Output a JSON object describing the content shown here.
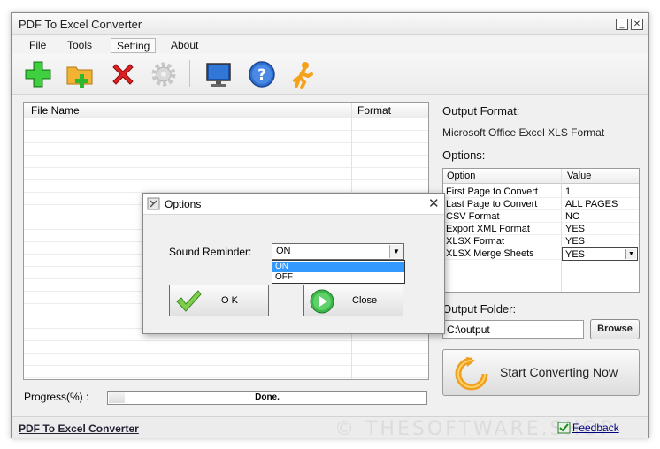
{
  "app": {
    "title": "PDF To Excel Converter"
  },
  "menu": {
    "items": [
      {
        "label": "File"
      },
      {
        "label": "Tools"
      },
      {
        "label": "Setting"
      },
      {
        "label": "About"
      }
    ]
  },
  "toolbar": {
    "icons": [
      "add-icon",
      "add-folder-icon",
      "remove-icon",
      "settings-icon",
      "monitor-icon",
      "help-icon",
      "running-man-icon"
    ]
  },
  "file_list": {
    "col_name": "File Name",
    "col_format": "Format"
  },
  "progress": {
    "label": "Progress(%)  :",
    "status": "Done.",
    "value": 0.05
  },
  "right_panel": {
    "output_format_label": "Output Format:",
    "output_format_value": "Microsoft Office Excel XLS Format",
    "options_label": "Options:",
    "options_table": {
      "col_option": "Option",
      "col_value": "Value",
      "rows": [
        {
          "option": "First Page to Convert",
          "value": "1"
        },
        {
          "option": "Last Page to Convert",
          "value": "ALL PAGES"
        },
        {
          "option": "CSV Format",
          "value": "NO"
        },
        {
          "option": "Export XML Format",
          "value": "YES"
        },
        {
          "option": "XLSX Format",
          "value": "YES"
        },
        {
          "option": "XLSX Merge Sheets",
          "value": "YES"
        }
      ]
    },
    "output_folder_label": "Output Folder:",
    "output_folder_value": "C:\\output",
    "browse_label": "Browse",
    "start_label": "Start Converting Now"
  },
  "status_bar": {
    "link": "PDF To Excel Converter",
    "feedback": "Feedback",
    "watermark": "© THESOFTWARE.SHOP"
  },
  "dialog": {
    "title": "Options",
    "sound_label": "Sound Reminder:",
    "sound_value": "ON",
    "sound_options": [
      "ON",
      "OFF"
    ],
    "ok_label": "O K",
    "close_label": "Close"
  },
  "colors": {
    "accent_blue": "#3399ff",
    "add_green": "#2eb82e",
    "remove_red": "#e02020",
    "start_orange": "#f0a020"
  }
}
